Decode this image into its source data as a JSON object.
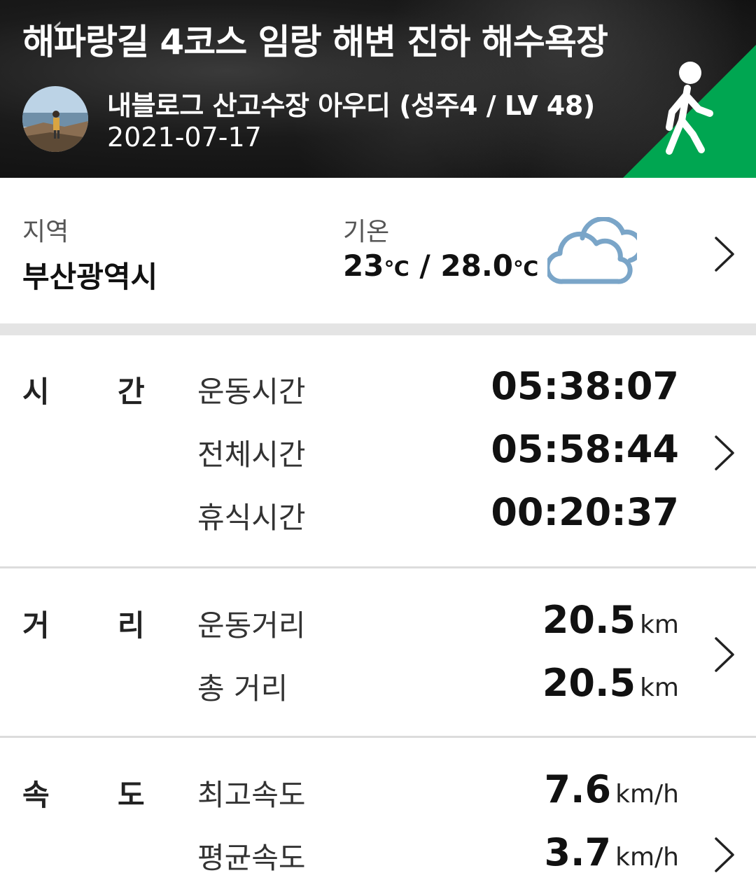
{
  "header": {
    "title": "해파랑길 4코스 임랑 해변 진하 해수욕장",
    "author": "내블로그 산고수장 아우디 (성주4 / LV 48)",
    "date": "2021-07-17",
    "activity_icon": "walking-person-icon",
    "accent_color": "#00a651"
  },
  "weather": {
    "region_label": "지역",
    "region_value": "부산광역시",
    "temp_label": "기온",
    "temp_low": "23",
    "temp_unit": "℃",
    "temp_sep": " / ",
    "temp_high": "28.0",
    "icon": "cloud-icon",
    "icon_color": "#7aa5c8"
  },
  "time": {
    "category_a": "시",
    "category_b": "간",
    "rows": [
      {
        "label": "운동시간",
        "value": "05:38:07"
      },
      {
        "label": "전체시간",
        "value": "05:58:44"
      },
      {
        "label": "휴식시간",
        "value": "00:20:37"
      }
    ]
  },
  "distance": {
    "category_a": "거",
    "category_b": "리",
    "unit": "km",
    "rows": [
      {
        "label": "운동거리",
        "value": "20.5"
      },
      {
        "label": "총 거리",
        "value": "20.5"
      }
    ]
  },
  "speed": {
    "category_a": "속",
    "category_b": "도",
    "unit": "km/h",
    "rows": [
      {
        "label": "최고속도",
        "value": "7.6"
      },
      {
        "label": "평균속도",
        "value": "3.7"
      }
    ]
  }
}
